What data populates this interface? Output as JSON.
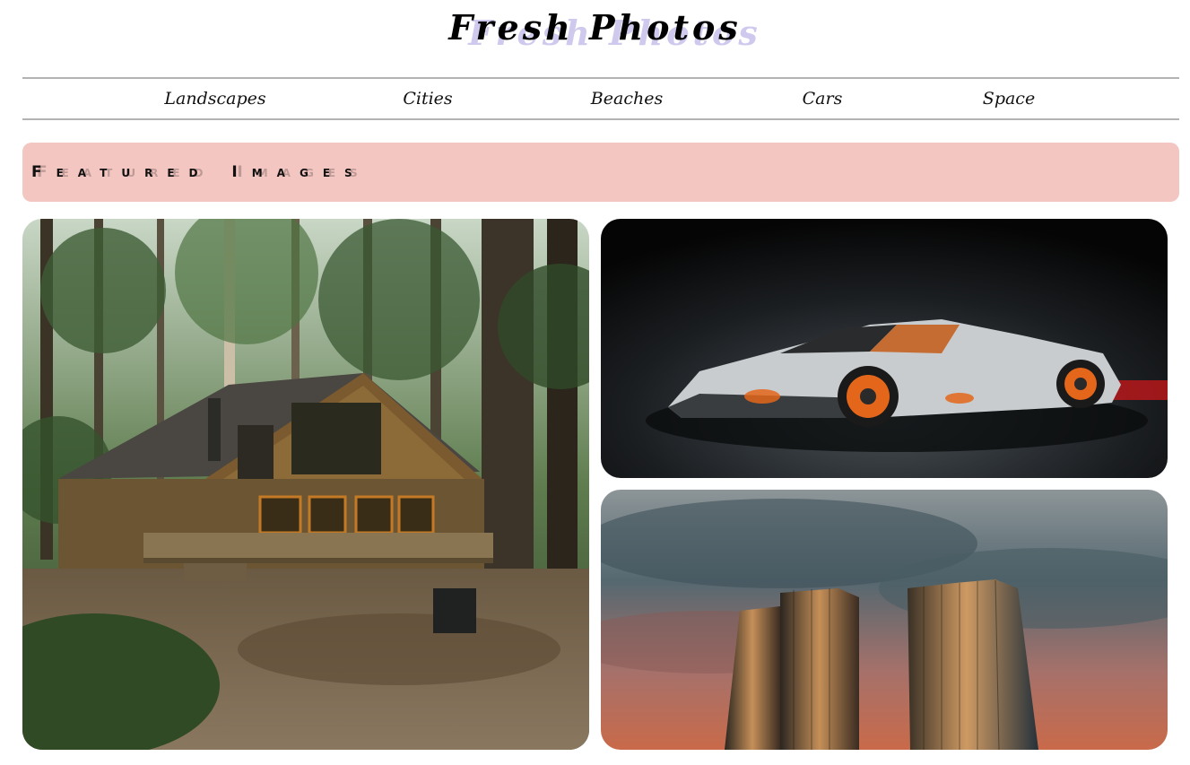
{
  "header": {
    "title": "Fresh Photos"
  },
  "nav": {
    "items": [
      {
        "label": "Landscapes"
      },
      {
        "label": "Cities"
      },
      {
        "label": "Beaches"
      },
      {
        "label": "Cars"
      },
      {
        "label": "Space"
      }
    ]
  },
  "featured": {
    "heading": "Featured Images"
  },
  "gallery": {
    "images": [
      {
        "subject": "wooden cabin in forest"
      },
      {
        "subject": "silver sports car with orange wheels"
      },
      {
        "subject": "twin skyscrapers at dusk"
      }
    ]
  },
  "colors": {
    "banner_bg": "#f4c6c1",
    "title_shadow": "#cfc9ee",
    "nav_border": "#b3b3b3"
  }
}
